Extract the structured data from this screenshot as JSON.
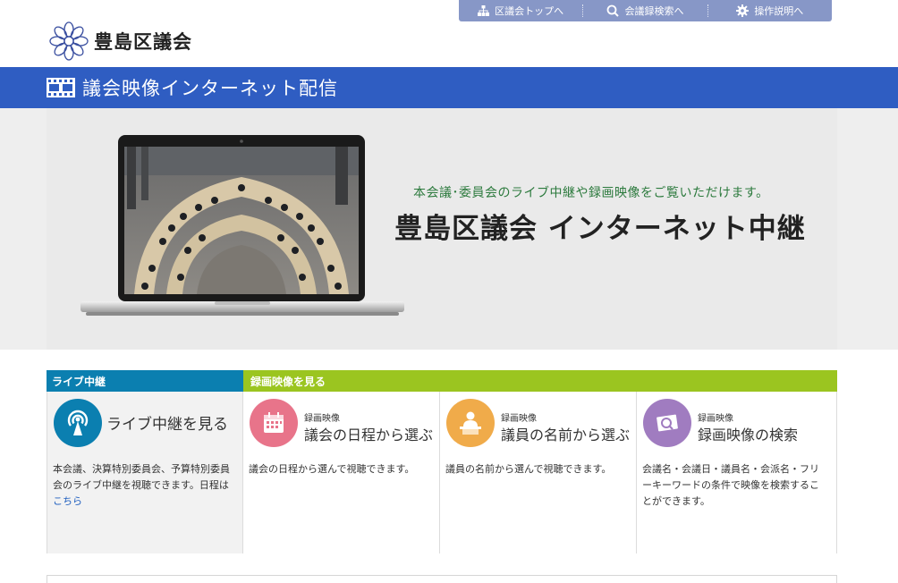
{
  "topnav": {
    "items": [
      {
        "label": "区議会トップへ",
        "icon": "sitemap-icon"
      },
      {
        "label": "会議録検索へ",
        "icon": "search-icon"
      },
      {
        "label": "操作説明へ",
        "icon": "gear-icon"
      }
    ]
  },
  "logo": {
    "text": "豊島区議会"
  },
  "banner": {
    "title": "議会映像インターネット配信"
  },
  "hero": {
    "subtitle": "本会議･委員会のライブ中継や録画映像をご覧いただけます。",
    "title": "豊島区議会 インターネット中継"
  },
  "sections": {
    "live_header": "ライブ中継",
    "recorded_header": "録画映像を見る"
  },
  "cards": [
    {
      "small": "",
      "title": "ライブ中継を見る",
      "desc": "本会議、決算特別委員会、予算特別委員会のライブ中継を視聴できます。日程は",
      "link": "こちら"
    },
    {
      "small": "録画映像",
      "title": "議会の日程から選ぶ",
      "desc": "議会の日程から選んで視聴できます。"
    },
    {
      "small": "録画映像",
      "title": "議員の名前から選ぶ",
      "desc": "議員の名前から選んで視聴できます。"
    },
    {
      "small": "録画映像",
      "title": "録画映像の検索",
      "desc": "会議名・会議日・議員名・会派名・フリーキーワードの条件で映像を検索することができます。"
    }
  ],
  "colors": {
    "banner": "#2f5dc2",
    "topnav": "#8797c7",
    "live": "#0b7fb0",
    "recorded": "#9bc520",
    "calendar_icon": "#e8748a",
    "person_icon": "#f0ab4a",
    "search_icon": "#a07cc0"
  }
}
